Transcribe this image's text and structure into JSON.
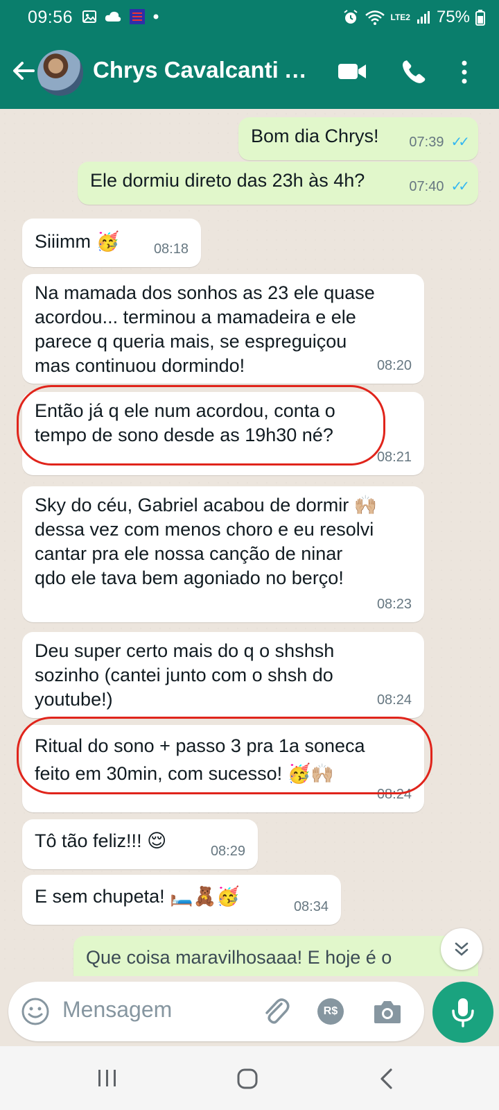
{
  "status_bar": {
    "time": "09:56",
    "battery": "75%",
    "network": "LTE2"
  },
  "header": {
    "contact_name": "Chrys Cavalcanti Al...",
    "color": "#0a7e6c"
  },
  "messages": [
    {
      "dir": "out",
      "text": "Bom dia Chrys!",
      "time": "07:39",
      "status": "read"
    },
    {
      "dir": "out",
      "text": "Ele dormiu direto das 23h às 4h?",
      "time": "07:40",
      "status": "read"
    },
    {
      "dir": "in",
      "text": "Siiimm 🥳",
      "time": "08:18"
    },
    {
      "dir": "in",
      "text": "Na mamada dos sonhos as 23 ele quase\nacordou... terminou a mamadeira e ele\nparece q queria mais, se espreguiçou\nmas continuou dormindo!",
      "time": "08:20"
    },
    {
      "dir": "in",
      "text": "Então já q ele num acordou, conta o\ntempo de sono desde as 19h30 né?",
      "time": "08:21",
      "highlighted": true
    },
    {
      "dir": "in",
      "text": "Sky do céu, Gabriel acabou de dormir 🙌🏼\ndessa vez com menos choro e eu resolvi\ncantar pra ele nossa canção de ninar\nqdo ele tava bem agoniado no berço!",
      "time": "08:23"
    },
    {
      "dir": "in",
      "text": "Deu super certo mais do q o shshsh\nsozinho (cantei junto com o shsh do\nyoutube!)",
      "time": "08:24"
    },
    {
      "dir": "in",
      "text": "Ritual do sono + passo 3 pra 1a soneca\nfeito em 30min, com sucesso! 🥳🙌🏼",
      "time": "08:24",
      "highlighted": true
    },
    {
      "dir": "in",
      "text": "Tô tão feliz!!! 😌",
      "time": "08:29"
    },
    {
      "dir": "in",
      "text": "E sem chupeta! 🛏️🧸🥳",
      "time": "08:34"
    },
    {
      "dir": "out",
      "text": "Que coisa maravilhosaaa! E hoje é o",
      "time": "",
      "partial": true
    }
  ],
  "input": {
    "placeholder": "Mensagem",
    "currency_label": "R$"
  },
  "colors": {
    "incoming": "#ffffff",
    "outgoing": "#e1f7cb",
    "read_ticks": "#34b7f1",
    "highlight_circle": "#e0241b",
    "mic_button": "#1aa37f"
  }
}
